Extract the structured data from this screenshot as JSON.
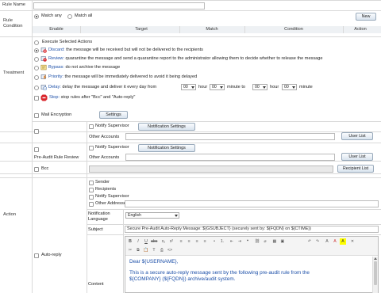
{
  "rule_name": {
    "label": "Rule Name",
    "value": ""
  },
  "rule_condition": {
    "label_line1": "Rule",
    "label_line2": "Condition",
    "match_any": "Match any",
    "match_all": "Match all",
    "new_button": "New",
    "columns": [
      "Enable",
      "Target",
      "Match",
      "Condition",
      "Action"
    ]
  },
  "treatment": {
    "label": "Treatment",
    "execute_selected": "Execute Selected Actions",
    "discard": {
      "name": "Discard:",
      "desc": "the message will be received but will not be delivered to the recipients"
    },
    "review": {
      "name": "Review:",
      "desc": "quarantine the message and send a quarantine report to the administrator allowing them to decide whether to release the message"
    },
    "bypass": {
      "name": "Bypass:",
      "desc": "do not archive the message"
    },
    "priority": {
      "name": "Priority:",
      "desc": "the message will be immediately delivered to avoid it being delayed"
    },
    "delay": {
      "name": "Delay:",
      "desc": "delay the message and deliver it every day from",
      "hour1": "00",
      "hour_label": "hour",
      "minute1": "00",
      "minute_to": "minute to",
      "hour2": "00",
      "minute2": "00",
      "minute_label": "minute"
    },
    "stop": {
      "name": "Stop:",
      "desc": "stop rules after \"Bcc\" and \"Auto-reply\""
    }
  },
  "action": {
    "label": "Action",
    "mail_encryption": {
      "label": "Mail Encryption",
      "settings": "Settings"
    },
    "notify_block_1": {
      "notify_supervisor": "Notify Supervisor",
      "notification_settings": "Notification Settings",
      "other_accounts": "Other Accounts",
      "user_list": "User List"
    },
    "pre_audit": {
      "label": "Pre-Audit Rule Review",
      "notify_supervisor": "Notify Supervisor",
      "notification_settings": "Notification Settings",
      "other_accounts": "Other Accounts",
      "user_list": "User List"
    },
    "bcc": {
      "label": "Bcc",
      "recipient_list": "Recipient List"
    },
    "auto_reply": {
      "label": "Auto-reply",
      "sender": "Sender",
      "recipients": "Recipients",
      "notify_supervisor": "Notify Supervisor",
      "other_addresses": "Other Addresses",
      "notification_language_l1": "Notification",
      "notification_language_l2": "Language",
      "language_value": "English",
      "subject_label": "Subject",
      "subject_value": "Secure Pre-Audit Auto-Reply Message: ${GSUBJECT} (securely sent by: ${FQDN} on ${CTIME})",
      "content_label": "Content",
      "content_line1": "Dear ${USERNAME},",
      "content_line2": "This is a secure auto-reply message sent by the following pre-audit rule from the",
      "content_line3": "${COMPANY} (${FQDN})  archive/audit system."
    }
  },
  "colors": {
    "stop_icon": "#d9262c",
    "link_blue": "#1c4fa8",
    "header_bg": "#eef1f4",
    "disabled_bg": "#e9e9e9"
  }
}
